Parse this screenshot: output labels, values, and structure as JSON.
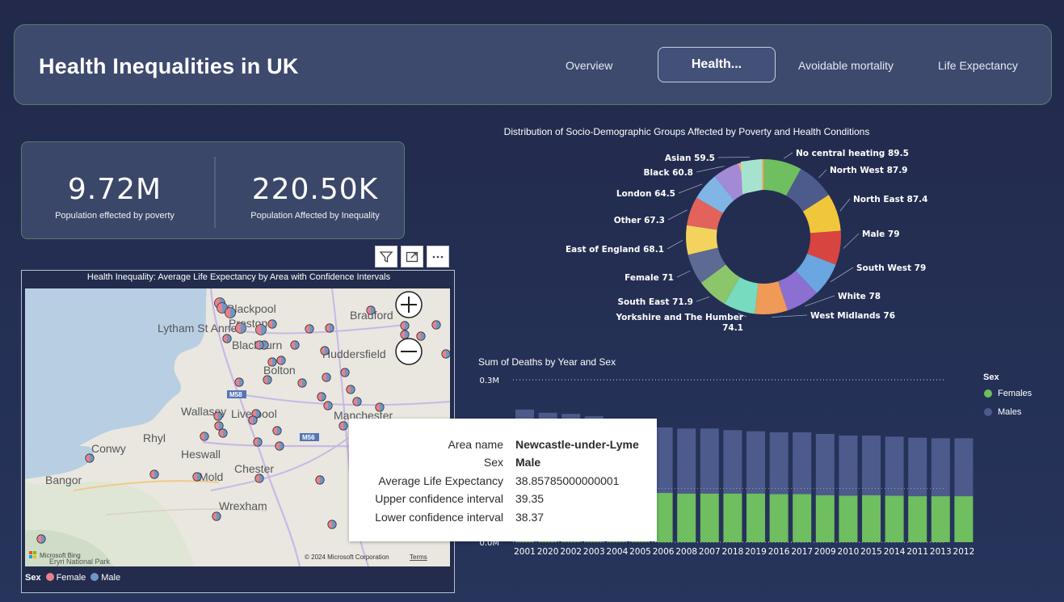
{
  "header": {
    "title": "Health Inequalities in UK",
    "tabs": [
      {
        "label": "Overview"
      },
      {
        "label": "Health..."
      },
      {
        "label": "Avoidable mortality"
      },
      {
        "label": "Life Expectancy"
      }
    ]
  },
  "kpis": [
    {
      "value": "9.72M",
      "label": "Population effected by poverty"
    },
    {
      "value": "220.50K",
      "label": "Population Affected by Inequality"
    }
  ],
  "map": {
    "title": "Health Inequality: Average Life Expectancy by Area with Confidence Intervals",
    "places": [
      "Blackpool",
      "Preston",
      "Lytham St Anne's",
      "Blackburn",
      "Bradford",
      "Huddersfield",
      "Bolton",
      "Wallasey",
      "Liverpool",
      "Manchester",
      "Rhyl",
      "Conwy",
      "Heswall",
      "Chester",
      "Bangor",
      "Mold",
      "Wrexham",
      "Eryri National Park"
    ],
    "roads": [
      "M58",
      "M56"
    ],
    "copyright": "© 2024 Microsoft Corporation",
    "terms": "Terms",
    "attribution": "Microsoft Bing",
    "legend_title": "Sex",
    "legend": [
      {
        "label": "Female",
        "color": "#e8828a"
      },
      {
        "label": "Male",
        "color": "#6f95c9"
      }
    ]
  },
  "toolbar": {
    "icons": [
      "filter-icon",
      "focus-mode-icon",
      "more-options-icon"
    ]
  },
  "tooltip": {
    "rows": [
      {
        "k": "Area name",
        "v": "Newcastle-under-Lyme",
        "bold": true
      },
      {
        "k": "Sex",
        "v": "Male"
      },
      {
        "k": "Average Life Expectancy",
        "v": "38.85785000000001"
      },
      {
        "k": "Upper confidence interval",
        "v": "39.35"
      },
      {
        "k": "Lower confidence interval",
        "v": "38.37"
      }
    ]
  },
  "chart_data": [
    {
      "type": "pie",
      "title": "Distribution of Socio-Demographic Groups Affected by Poverty and Health Conditions",
      "donut": true,
      "labels": [
        "No central heating",
        "North West",
        "North East",
        "Male",
        "South West",
        "White",
        "West Midlands",
        "Yorkshire and The Humber",
        "South East",
        "Female",
        "East of England",
        "Other",
        "London",
        "Black",
        "Asian"
      ],
      "values": [
        89.5,
        87.9,
        87.4,
        79,
        79,
        78,
        76,
        74.1,
        71.9,
        71,
        68.1,
        67.3,
        64.5,
        60.8,
        59.5
      ],
      "colors": [
        "#6fbe5f",
        "#4c5a8c",
        "#f0c63a",
        "#d8443f",
        "#6aa6df",
        "#8b6fd1",
        "#ef9a56",
        "#76dbbf",
        "#8cc66b",
        "#5d6a93",
        "#f3d35e",
        "#e2635b",
        "#80b5e6",
        "#a38ad6",
        "#f5a873",
        "#a6e3cf",
        "#4e8b48"
      ]
    },
    {
      "type": "bar",
      "stacked": true,
      "title": "Sum of Deaths  by Year and Sex",
      "categories": [
        "2001",
        "2020",
        "2002",
        "2003",
        "2004",
        "2005",
        "2006",
        "2008",
        "2007",
        "2018",
        "2019",
        "2016",
        "2017",
        "2009",
        "2010",
        "2015",
        "2014",
        "2011",
        "2013",
        "2012"
      ],
      "series": [
        {
          "name": "Females",
          "color": "#6fbe5f",
          "values": [
            0.097,
            0.096,
            0.095,
            0.094,
            0.093,
            0.092,
            0.091,
            0.09,
            0.09,
            0.09,
            0.09,
            0.089,
            0.089,
            0.087,
            0.086,
            0.087,
            0.086,
            0.085,
            0.085,
            0.085
          ]
        },
        {
          "name": "Males",
          "color": "#4c5a8c",
          "values": [
            0.148,
            0.143,
            0.142,
            0.139,
            0.13,
            0.128,
            0.121,
            0.12,
            0.12,
            0.117,
            0.115,
            0.114,
            0.114,
            0.113,
            0.111,
            0.11,
            0.109,
            0.108,
            0.107,
            0.107
          ]
        }
      ],
      "ytick_labels": [
        "0.3M",
        "0.0M"
      ],
      "legend_title": "Sex",
      "ylim": [
        0,
        0.3
      ]
    }
  ]
}
